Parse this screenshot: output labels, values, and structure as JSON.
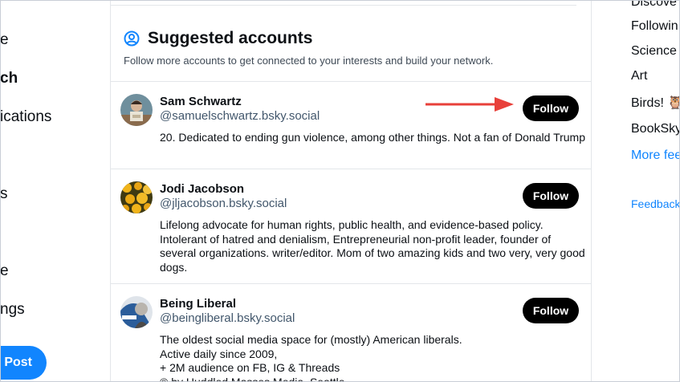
{
  "left_nav": {
    "items": [
      "e",
      "ch",
      "ications",
      "s",
      "e",
      "ngs"
    ],
    "post_label": "Post"
  },
  "suggested": {
    "title": "Suggested accounts",
    "description": "Follow more accounts to get connected to your interests and build your network."
  },
  "accounts": [
    {
      "name": "Sam Schwartz",
      "handle": "@samuelschwartz.bsky.social",
      "bio": "20. Dedicated to ending gun violence, among other things. Not a fan of Donald Trump",
      "follow_label": "Follow"
    },
    {
      "name": "Jodi Jacobson",
      "handle": "@jljacobson.bsky.social",
      "bio": "Lifelong advocate for human rights, public health, and evidence-based policy. Intolerant of hatred and denialism, Entrepreneurial non-profit leader, founder of several organizations. writer/editor. Mom of two amazing kids and two very, very good dogs.",
      "follow_label": "Follow"
    },
    {
      "name": "Being Liberal",
      "handle": "@beingliberal.bsky.social",
      "bio_lines": [
        "The oldest social media space for (mostly) American liberals.",
        "Active daily since 2009,",
        "+ 2M audience on FB, IG & Threads",
        "© by Huddled Masses Media, Seattle"
      ],
      "follow_label": "Follow"
    }
  ],
  "right_col": {
    "feeds": [
      "Discove",
      "Followin",
      "Science",
      "Art",
      "Birds! 🦉",
      "BookSky"
    ],
    "more_label": "More fee",
    "feedback_label": "Feedback"
  },
  "colors": {
    "accent": "#1185fe",
    "arrow": "#e8403a",
    "follow_bg": "#000000"
  }
}
